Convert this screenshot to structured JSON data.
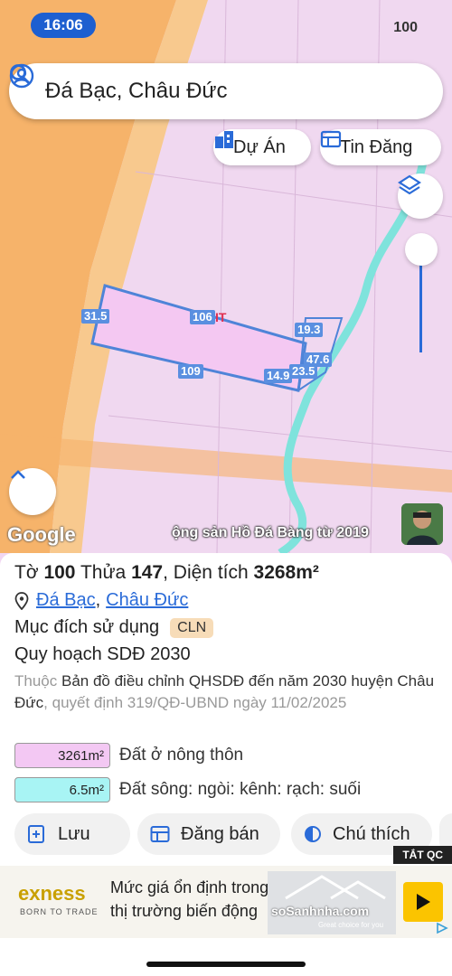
{
  "status_bar": {
    "time": "16:06",
    "battery": "100"
  },
  "search": {
    "query": "Đá Bạc, Châu Đức"
  },
  "chips": {
    "projects": "Dự Án",
    "listings": "Tin Đăng"
  },
  "map": {
    "edge_labels": [
      "31.5",
      "106",
      "19.3",
      "47.6",
      "23.5",
      "14.9",
      "109"
    ],
    "zone_code": "IT",
    "google_logo": "Google",
    "watermark": "ộng sản Hồ Đá Bàng từ 2019"
  },
  "parcel": {
    "sheet_label": "Tờ",
    "sheet_no": "100",
    "plot_label": "Thửa",
    "plot_no": "147",
    "area_label": "Diện tích",
    "area": "3268m²",
    "commune": "Đá Bạc",
    "separator": ",",
    "district": "Châu Đức",
    "purpose_label": "Mục đích sử dụng",
    "purpose_code": "CLN",
    "plan_title": "Quy hoạch SDĐ 2030",
    "plan_note_prefix": "Thuộc",
    "plan_note_main": "Bản đồ điều chỉnh QHSDĐ đến năm 2030 huyện Châu Đức",
    "plan_note_suffix": ", quyết định 319/QĐ-UBND ngày 11/02/2025"
  },
  "legend": [
    {
      "area": "3261m²",
      "desc": "Đất ở nông thôn",
      "color": "#f3c8f3"
    },
    {
      "area": "6.5m²",
      "desc": "Đất sông: ngòi: kênh: rạch: suối",
      "color": "#a8f4f4"
    }
  ],
  "actions": {
    "save": "Lưu",
    "post": "Đăng bán",
    "legend": "Chú thích"
  },
  "ad": {
    "close": "TẮT QC",
    "brand": "exness",
    "tagline": "BORN TO TRADE",
    "line1": "Mức giá ổn định trong",
    "line2": "thị trường biến động",
    "overlay": "soSanhnha.com",
    "overlay_sub": "Great choice for you"
  },
  "colors": {
    "road": "#f6b36a",
    "land": "#f0d8f0",
    "river": "#7fe3dc",
    "parcel_line": "#4f84d8",
    "accent": "#2a6bd8"
  }
}
